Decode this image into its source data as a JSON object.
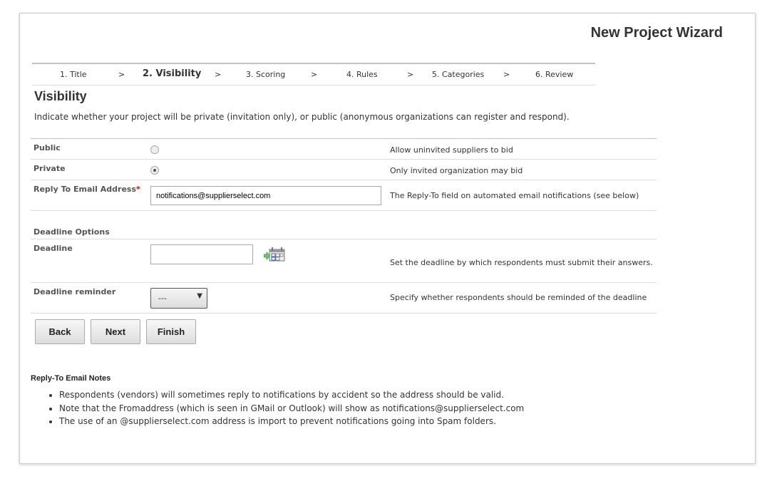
{
  "header": {
    "title": "New Project Wizard"
  },
  "steps": [
    {
      "label": "1. Title"
    },
    {
      "label": "2. Visibility"
    },
    {
      "label": "3. Scoring"
    },
    {
      "label": "4. Rules"
    },
    {
      "label": "5. Categories"
    },
    {
      "label": "6. Review"
    }
  ],
  "separator": ">",
  "section": {
    "title": "Visibility",
    "intro": "Indicate whether your project will be private (invitation only), or public (anonymous organizations can register and respond)."
  },
  "form": {
    "public": {
      "label": "Public",
      "desc": "Allow uninvited suppliers to bid",
      "selected": false
    },
    "private": {
      "label": "Private",
      "desc": "Only invited organization may bid",
      "selected": true
    },
    "reply": {
      "label": "Reply To Email Address",
      "required": "*",
      "value": "notifications@supplierselect.com",
      "desc": "The Reply-To field on automated email notifications (see below)"
    },
    "deadline_options": "Deadline Options",
    "deadline": {
      "label": "Deadline",
      "value": "",
      "desc": "Set the deadline by which respondents must submit their answers."
    },
    "reminder": {
      "label": "Deadline reminder",
      "value": "---",
      "desc": "Specify whether respondents should be reminded of the deadline"
    }
  },
  "buttons": {
    "back": "Back",
    "next": "Next",
    "finish": "Finish"
  },
  "notes": {
    "title": "Reply-To Email Notes",
    "items": [
      "Respondents (vendors) will sometimes reply to notifications by accident so the address should be valid.",
      "Note that the Fromaddress (which is seen in GMail or Outlook) will show as notifications@supplierselect.com",
      "The use of an @supplierselect.com address is import to prevent notifications going into Spam folders."
    ]
  }
}
